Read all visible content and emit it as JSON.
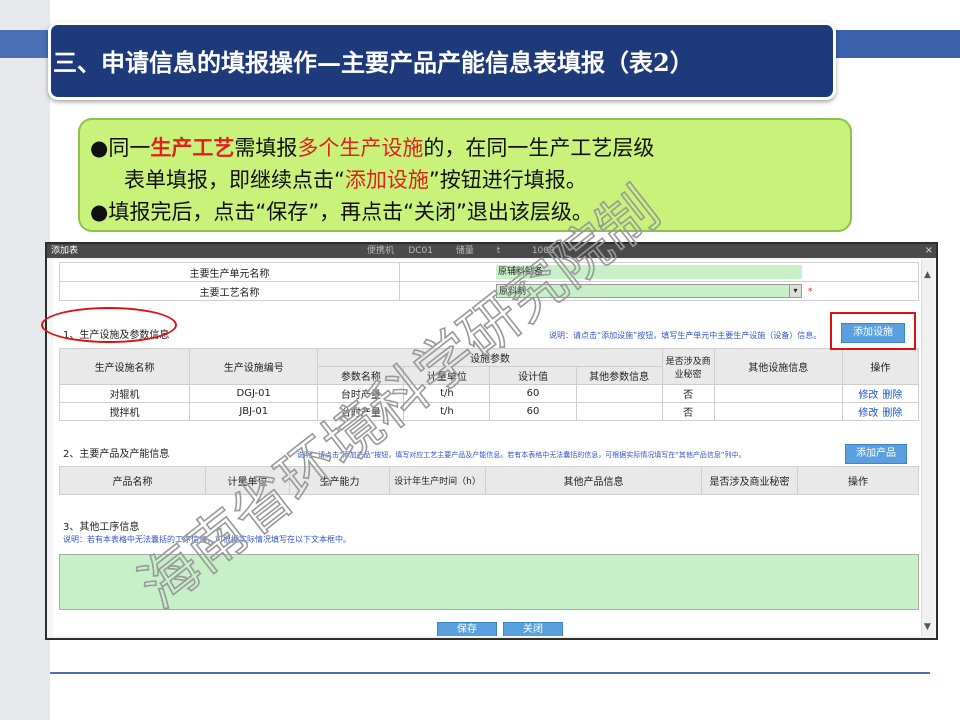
{
  "slide": {
    "title": "三、申请信息的填报操作—主要产品产能信息表填报（表2）",
    "notes": {
      "line1_a": "●同一",
      "line1_b": "生产工艺",
      "line1_c": "需填报",
      "line1_d": "多个生产设施",
      "line1_e": "的，在同一生产工艺层级",
      "line2_a": "表单填报，即继续点击“",
      "line2_b": "添加设施",
      "line2_c": "”按钮进行填报。",
      "line3": "●填报完后，点击“保存”，再点击“关闭”退出该层级。"
    },
    "watermark": "海南省环境科学研究院制"
  },
  "dialog": {
    "title": "添加表",
    "close": "×",
    "background_ghost": {
      "label1": "便携机",
      "label2": "DC01",
      "label3": "储量",
      "label4": "t",
      "label5": "1000"
    },
    "top_fields": {
      "unit_label": "主要生产单元名称",
      "unit_value": "原辅料制备",
      "process_label": "主要工艺名称",
      "process_value": "原料制",
      "required": "*"
    },
    "section1": {
      "label": "1、生产设施及参数信息",
      "hint": "说明：请点击“添加设施”按钮，填写生产单元中主要生产设施（设备）信息。",
      "add_button": "添加设施",
      "headers": {
        "name": "生产设施名称",
        "code": "生产设施编号",
        "param_group": "设施参数",
        "param_name": "参数名称",
        "unit": "计量单位",
        "design_value": "设计值",
        "other_params": "其他参数信息",
        "secret": "是否涉及商业秘密",
        "other_info": "其他设施信息",
        "ops": "操作"
      },
      "rows": [
        {
          "name": "对辊机",
          "code": "DGJ-01",
          "param": "台时产量",
          "unit": "t/h",
          "value": "60",
          "other": "",
          "secret": "否",
          "info": "",
          "edit": "修改",
          "delete": "删除"
        },
        {
          "name": "搅拌机",
          "code": "JBJ-01",
          "param": "台时产量",
          "unit": "t/h",
          "value": "60",
          "other": "",
          "secret": "否",
          "info": "",
          "edit": "修改",
          "delete": "删除"
        }
      ]
    },
    "section2": {
      "label": "2、主要产品及产能信息",
      "hint": "说明：请点击“添加产品”按钮，填写对应工艺主要产品及产能信息。若有本表格中无法囊括的信息，可根据实际情况填写在“其他产品信息”列中。",
      "add_button": "添加产品",
      "headers": {
        "name": "产品名称",
        "unit": "计量单位",
        "capacity": "生产能力",
        "hours": "设计年生产时间（h）",
        "other": "其他产品信息",
        "secret": "是否涉及商业秘密",
        "ops": "操作"
      }
    },
    "section3": {
      "label": "3、其他工序信息",
      "hint": "说明：若有本表格中无法囊括的工序信息，可根据实际情况填写在以下文本框中。"
    },
    "footer": {
      "save": "保存",
      "close": "关闭"
    }
  },
  "colors": {
    "title_bg": "#1f3a7a",
    "note_bg": "#c9f27a",
    "highlight": "#e02020",
    "field_green": "#c8f0c8",
    "button_blue": "#5aa0e0"
  }
}
